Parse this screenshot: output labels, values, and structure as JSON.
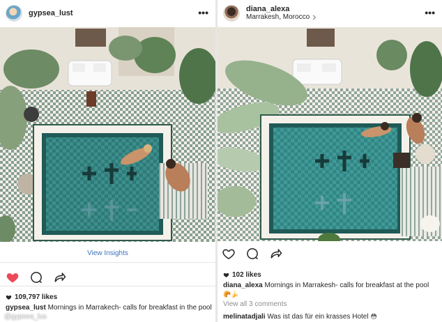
{
  "left_post": {
    "username": "gypsea_lust",
    "more_icon": "more-horizontal-icon",
    "insights_link": "View Insights",
    "likes_count": "109,797 likes",
    "caption_user": "gypsea_lust",
    "caption_text": "Mornings in Marrakech- calls for breakfast in the pool",
    "watermark": "@gypsea_lus",
    "like_color": "#ed4956"
  },
  "right_post": {
    "username": "diana_alexa",
    "location": "Marrakesh, Morocco",
    "likes_count": "102 likes",
    "caption_user": "diana_alexa",
    "caption_text": "Mornings in Marrakesh- calls for breakfast at the pool",
    "caption_emoji": "🥐🍌",
    "view_comments": "View all 3 comments",
    "comment_user": "melinatadjali",
    "comment_text": "Was ist das für ein krasses Hotel",
    "comment_emoji": "😳"
  },
  "icons": [
    "heart-icon",
    "comment-icon",
    "share-icon",
    "chevron-right-icon"
  ],
  "colors": {
    "link": "#3b73b9",
    "text": "#262626",
    "muted": "#8e8e8e",
    "like": "#ed4956"
  }
}
